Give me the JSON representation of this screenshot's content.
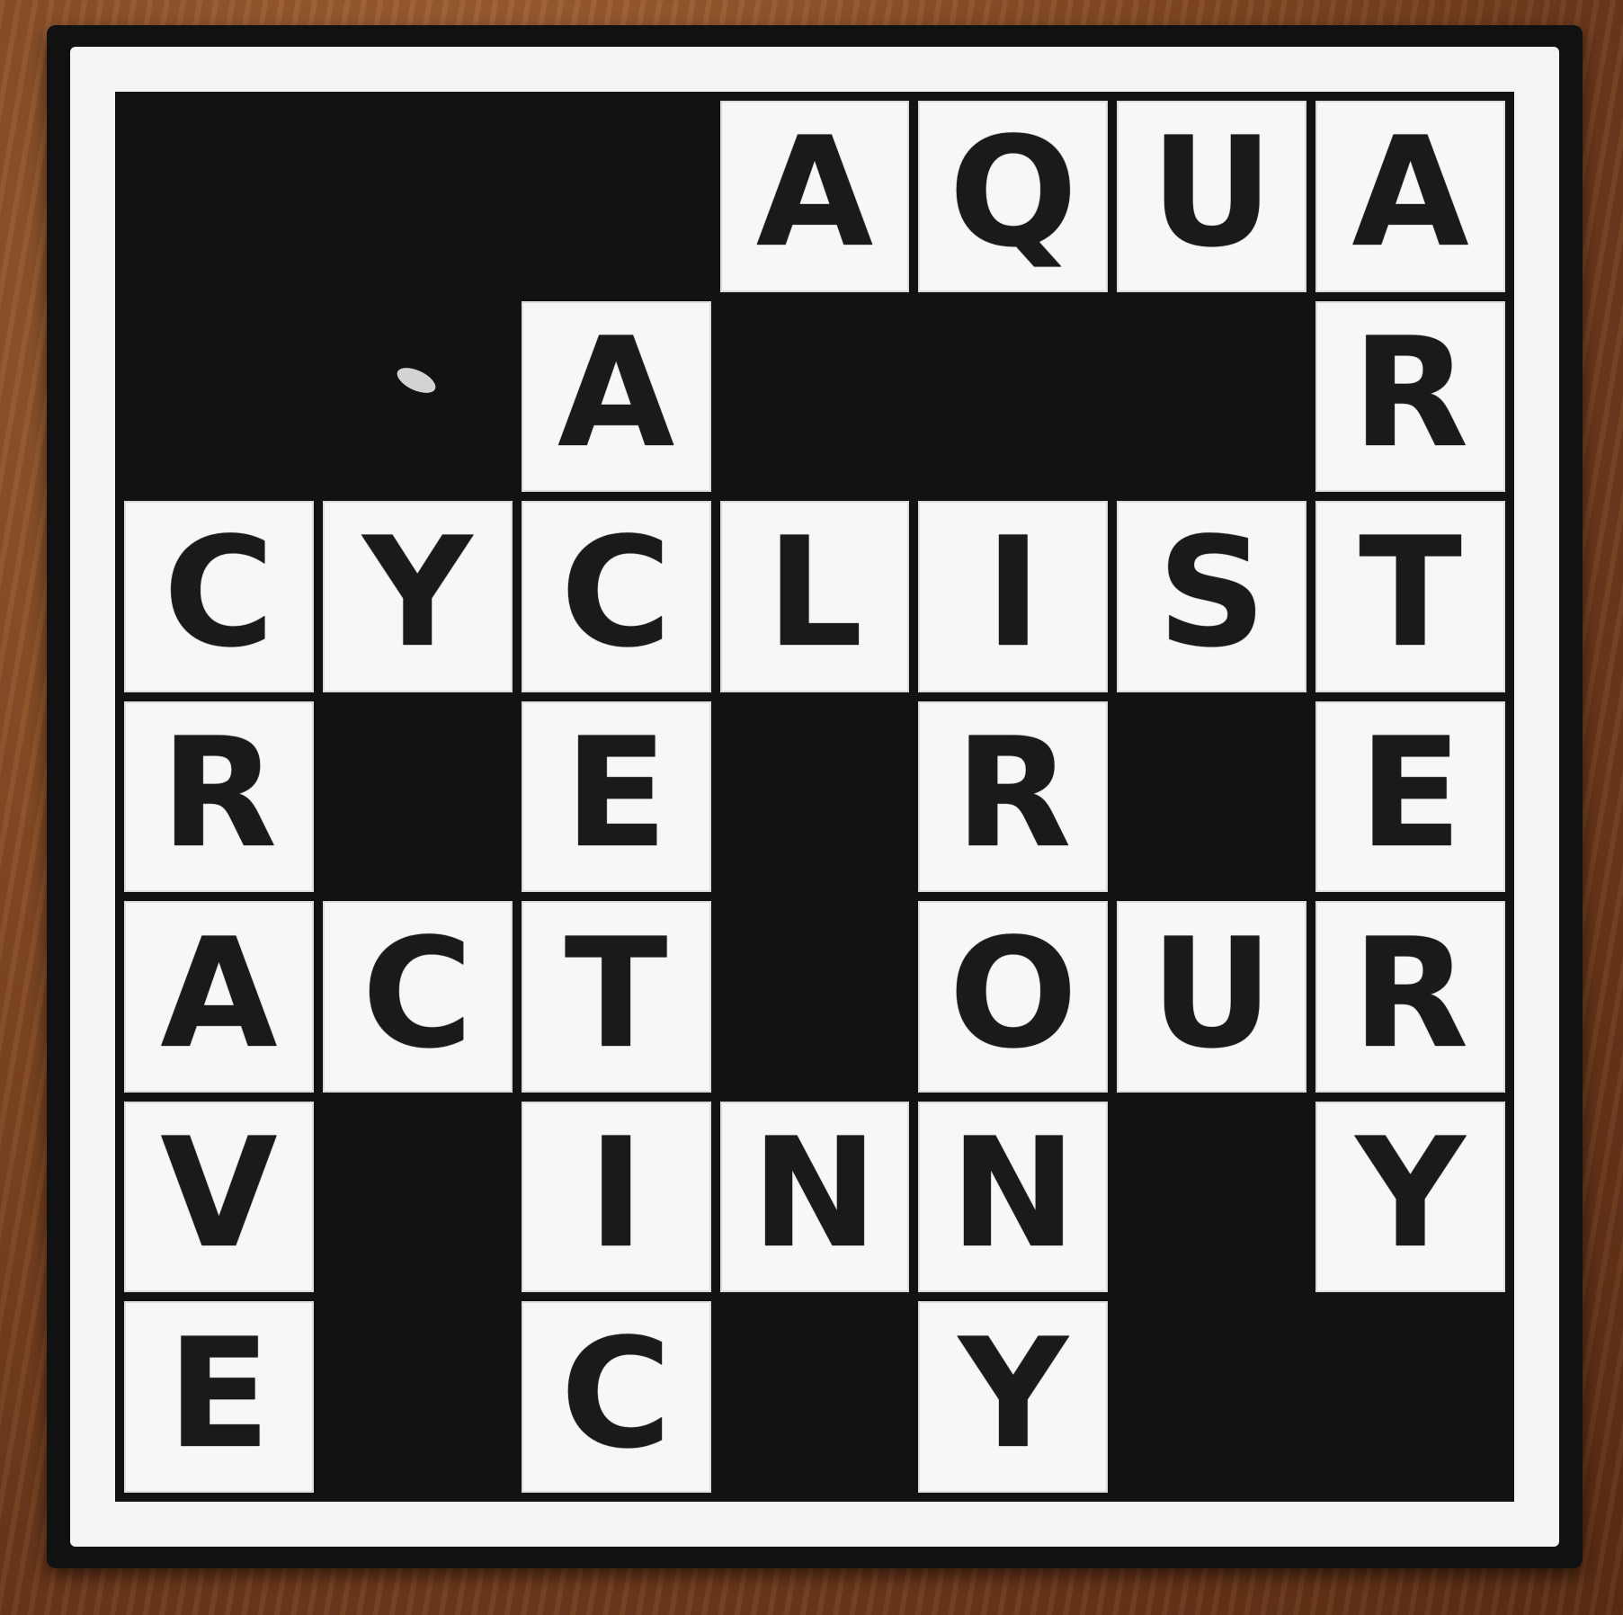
{
  "puzzle": {
    "rows": 7,
    "cols": 7,
    "grid": [
      [
        "#",
        "#",
        "#",
        "A",
        "Q",
        "U",
        "A"
      ],
      [
        "#",
        "#",
        "A",
        "#",
        "#",
        "#",
        "R"
      ],
      [
        "C",
        "Y",
        "C",
        "L",
        "I",
        "S",
        "T"
      ],
      [
        "R",
        "#",
        "E",
        "#",
        "R",
        "#",
        "E"
      ],
      [
        "A",
        "C",
        "T",
        "#",
        "O",
        "U",
        "R"
      ],
      [
        "V",
        "#",
        "I",
        "N",
        "N",
        "#",
        "Y"
      ],
      [
        "E",
        "#",
        "C",
        "#",
        "Y",
        "#",
        "#"
      ]
    ]
  },
  "colors": {
    "black_square": "#121212",
    "white_square": "#f7f7f5",
    "letter": "#1a1a1a",
    "frame": "#f4f4f2",
    "table_wood": "#8a4f28"
  }
}
